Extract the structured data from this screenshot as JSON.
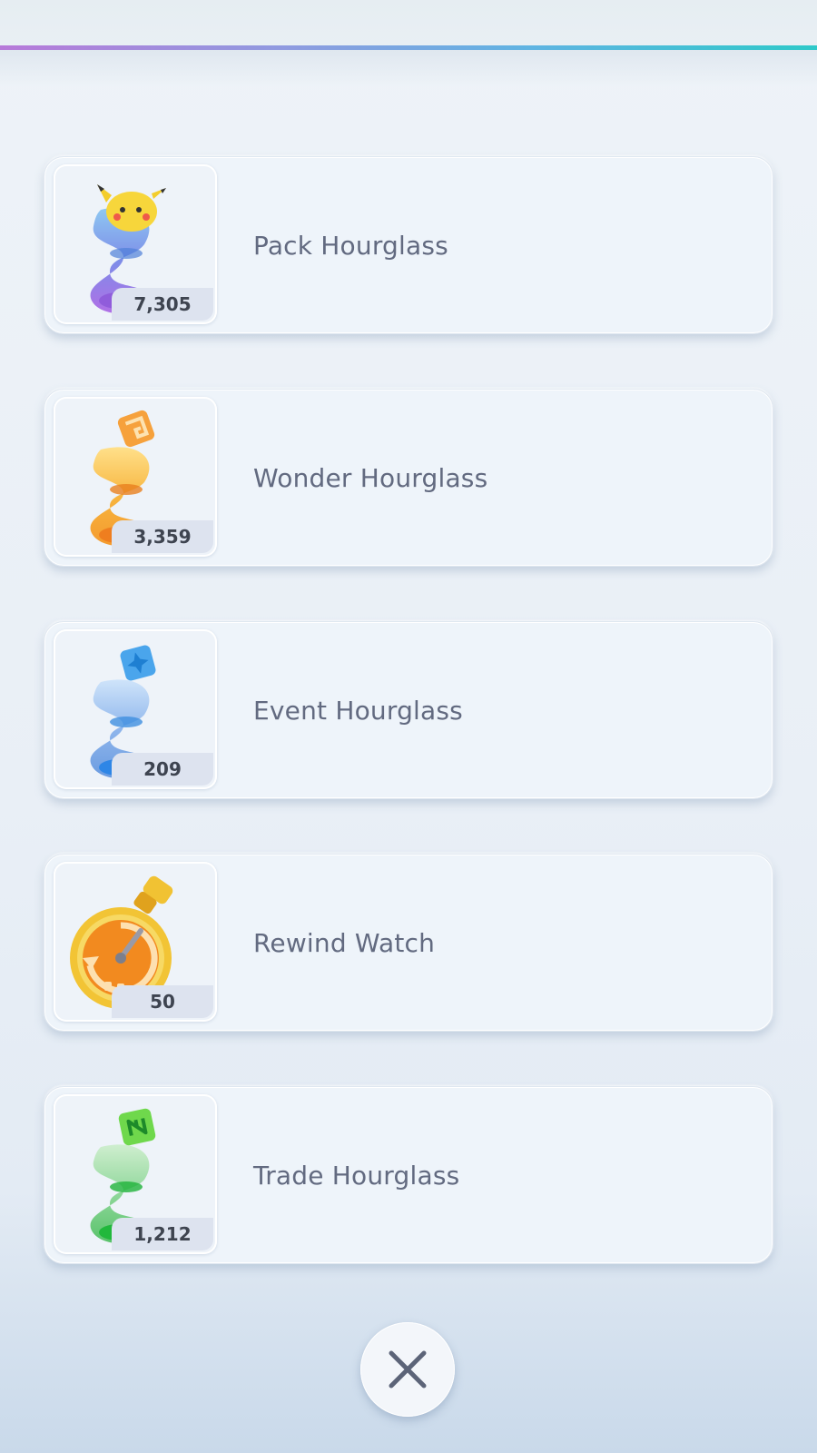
{
  "items": [
    {
      "label": "Pack Hourglass",
      "count": "7,305",
      "icon": "pack-hourglass-icon"
    },
    {
      "label": "Wonder Hourglass",
      "count": "3,359",
      "icon": "wonder-hourglass-icon"
    },
    {
      "label": "Event Hourglass",
      "count": "209",
      "icon": "event-hourglass-icon"
    },
    {
      "label": "Rewind Watch",
      "count": "50",
      "icon": "rewind-watch-icon"
    },
    {
      "label": "Trade Hourglass",
      "count": "1,212",
      "icon": "trade-hourglass-icon"
    }
  ],
  "close_icon": "close-icon",
  "colors": {
    "accent_gradient": [
      "#b77ad9",
      "#5fb4e2",
      "#2ec9c9"
    ],
    "label_text": "#626a80",
    "count_badge": "#dde3ef"
  }
}
